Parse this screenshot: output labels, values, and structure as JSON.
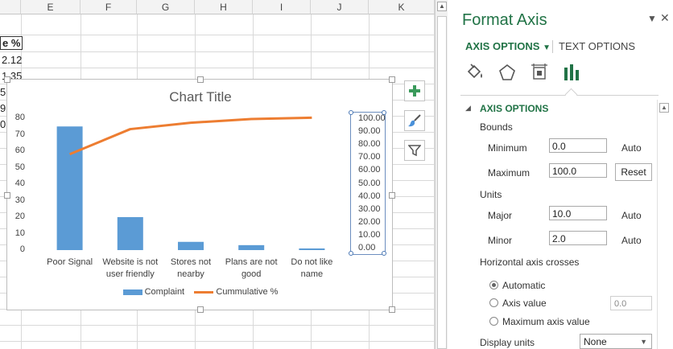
{
  "spreadsheet": {
    "columns": [
      "E",
      "F",
      "G",
      "H",
      "I",
      "J",
      "K"
    ],
    "cells": [
      "e %",
      "2.12",
      "1.35",
      "5",
      "9",
      "0"
    ]
  },
  "chart": {
    "title": "Chart Title",
    "legend": [
      "Complaint",
      "Cummulative %"
    ],
    "side_buttons": [
      "chart-elements",
      "chart-styles",
      "chart-filters"
    ]
  },
  "chart_data": {
    "type": "bar",
    "title": "Chart Title",
    "categories": [
      "Poor Signal",
      "Website is not user friendly",
      "Stores not nearby",
      "Plans are not good",
      "Do not like name"
    ],
    "category_labels": [
      [
        "Poor Signal"
      ],
      [
        "Website is not",
        "user friendly"
      ],
      [
        "Stores not",
        "nearby"
      ],
      [
        "Plans are not",
        "good"
      ],
      [
        "Do not like",
        "name"
      ]
    ],
    "series": [
      {
        "name": "Complaint",
        "type": "bar",
        "axis": "primary",
        "color": "#5b9bd5",
        "values": [
          75,
          20,
          5,
          3,
          1
        ]
      },
      {
        "name": "Cummulative %",
        "type": "line",
        "axis": "secondary",
        "color": "#ed7d31",
        "values": [
          72.8,
          92.2,
          97.1,
          100.0,
          101.0
        ]
      }
    ],
    "primary_axis": {
      "ylim": [
        0,
        80
      ],
      "ticks": [
        "0",
        "10",
        "20",
        "30",
        "40",
        "50",
        "60",
        "70",
        "80"
      ]
    },
    "secondary_axis": {
      "ylim": [
        0,
        100
      ],
      "ticks": [
        "0.00",
        "10.00",
        "20.00",
        "30.00",
        "40.00",
        "50.00",
        "60.00",
        "70.00",
        "80.00",
        "90.00",
        "100.00"
      ]
    },
    "legend_position": "bottom",
    "grid": false
  },
  "pane": {
    "title": "Format Axis",
    "tabs": {
      "axis_options": "AXIS OPTIONS",
      "text_options": "TEXT OPTIONS"
    },
    "icons": [
      "paint-bucket-icon",
      "pentagon-icon",
      "size-properties-icon",
      "bar-chart-icon"
    ],
    "section": "AXIS OPTIONS",
    "bounds": {
      "label": "Bounds",
      "minimum_label": "Minimum",
      "minimum_value": "0.0",
      "minimum_state": "Auto",
      "maximum_label": "Maximum",
      "maximum_value": "100.0",
      "reset": "Reset"
    },
    "units": {
      "label": "Units",
      "major_label": "Major",
      "major_value": "10.0",
      "major_state": "Auto",
      "minor_label": "Minor",
      "minor_value": "2.0",
      "minor_state": "Auto"
    },
    "crosses": {
      "label": "Horizontal axis crosses",
      "automatic": "Automatic",
      "axis_value": "Axis value",
      "axis_value_input": "0.0",
      "maximum": "Maximum axis value"
    },
    "display_units": {
      "label": "Display units",
      "value": "None"
    }
  }
}
